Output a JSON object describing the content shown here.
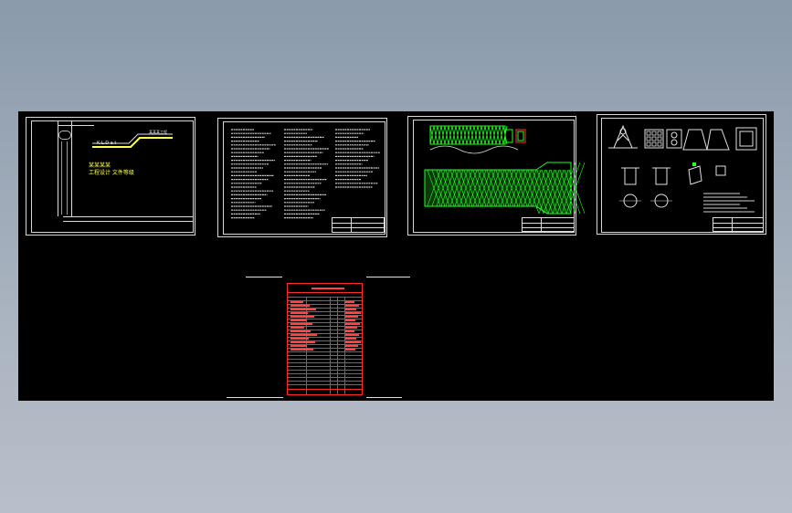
{
  "sheet1": {
    "title_plate": "K.L.D a.t",
    "project_label": "某某某工程",
    "line1": "某某某某",
    "line2": "工程设计 文件等级"
  },
  "colors": {
    "background_top": "#8a9aab",
    "canvas": "#000000",
    "border": "#d8d8d8",
    "green": "#22ff22",
    "red": "#ff2a2a",
    "yellow": "#ffff55"
  },
  "icons": [
    "cad-sheet-frame",
    "grate-pattern",
    "column-detail"
  ]
}
